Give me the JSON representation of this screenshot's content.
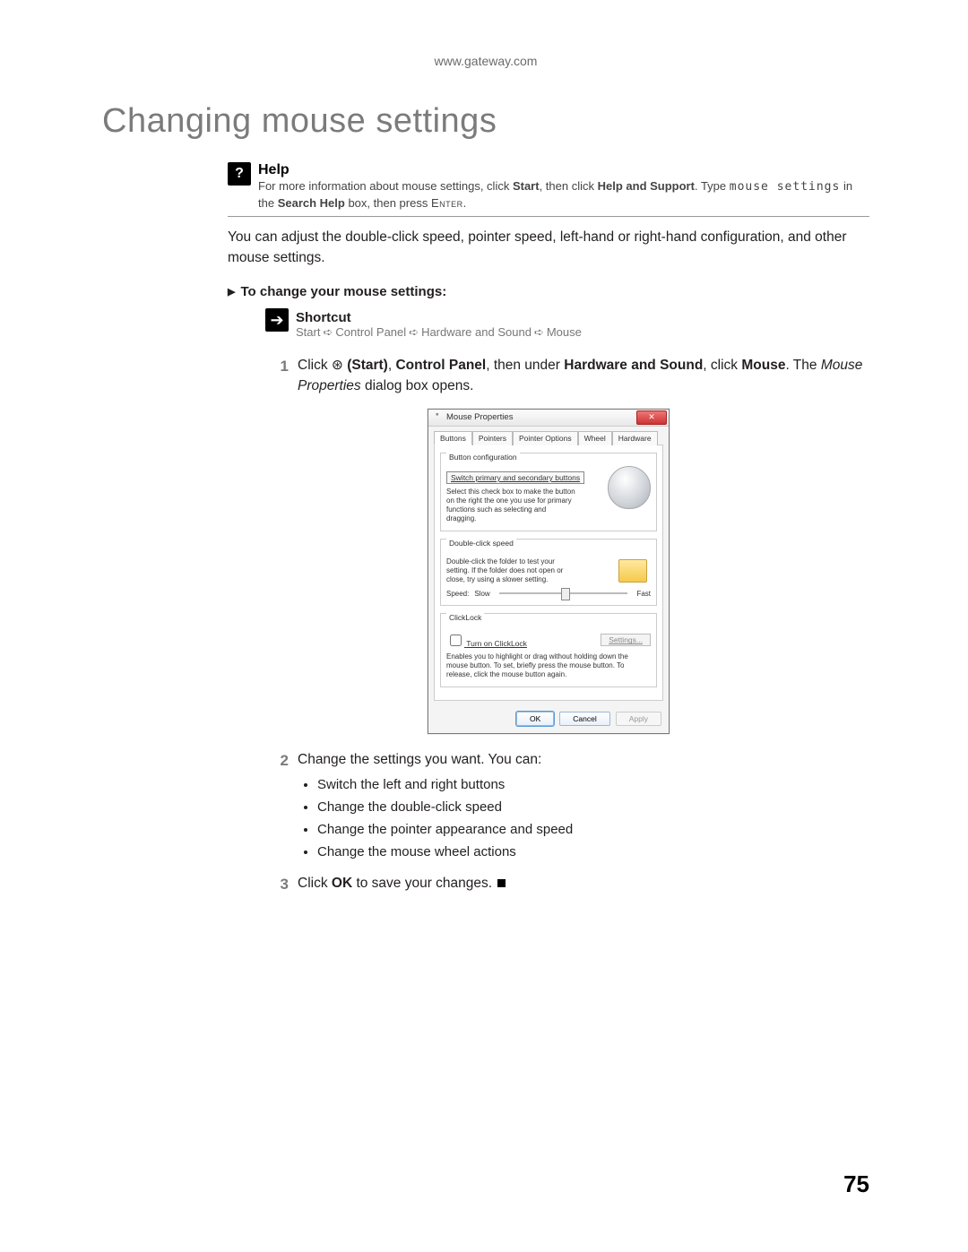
{
  "header_url": "www.gateway.com",
  "title": "Changing mouse settings",
  "help": {
    "label": "Help",
    "pre": "For more information about mouse settings, click ",
    "start": "Start",
    "mid1": ", then click ",
    "hs": "Help and Support",
    "mid2": ". Type ",
    "query": "mouse settings",
    "mid3": " in the ",
    "box": "Search Help",
    "mid4": " box, then press ",
    "enter": "Enter",
    "end": "."
  },
  "intro": "You can adjust the double-click speed, pointer speed, left-hand or right-hand configuration, and other mouse settings.",
  "subhead": "To change your mouse settings:",
  "shortcut": {
    "label": "Shortcut",
    "path": [
      "Start",
      "Control Panel",
      "Hardware and Sound",
      "Mouse"
    ]
  },
  "steps": {
    "s1": {
      "num": "1",
      "pre": "Click ",
      "startp": "(Start)",
      "mid1": ", ",
      "cp": "Control Panel",
      "mid2": ", then under ",
      "hw": "Hardware and Sound",
      "mid3": ", click ",
      "mouse": "Mouse",
      "mid4": ". The ",
      "mp": "Mouse Properties",
      "end": " dialog box opens."
    },
    "s2": {
      "num": "2",
      "text": "Change the settings you want. You can:",
      "bullets": [
        "Switch the left and right buttons",
        "Change the double-click speed",
        "Change the pointer appearance and speed",
        "Change the mouse wheel actions"
      ]
    },
    "s3": {
      "num": "3",
      "pre": "Click ",
      "ok": "OK",
      "post": " to save your changes."
    }
  },
  "dialog": {
    "title": "Mouse Properties",
    "tabs": [
      "Buttons",
      "Pointers",
      "Pointer Options",
      "Wheel",
      "Hardware"
    ],
    "f1": {
      "legend": "Button configuration",
      "switch": "Switch primary and secondary buttons",
      "desc": "Select this check box to make the button on the right the one you use for primary functions such as selecting and dragging."
    },
    "f2": {
      "legend": "Double-click speed",
      "desc": "Double-click the folder to test your setting. If the folder does not open or close, try using a slower setting.",
      "speed": "Speed:",
      "slow": "Slow",
      "fast": "Fast"
    },
    "f3": {
      "legend": "ClickLock",
      "turn": "Turn on ClickLock",
      "settings": "Settings...",
      "desc": "Enables you to highlight or drag without holding down the mouse button. To set, briefly press the mouse button. To release, click the mouse button again."
    },
    "btn_ok": "OK",
    "btn_cancel": "Cancel",
    "btn_apply": "Apply"
  },
  "page_number": "75"
}
